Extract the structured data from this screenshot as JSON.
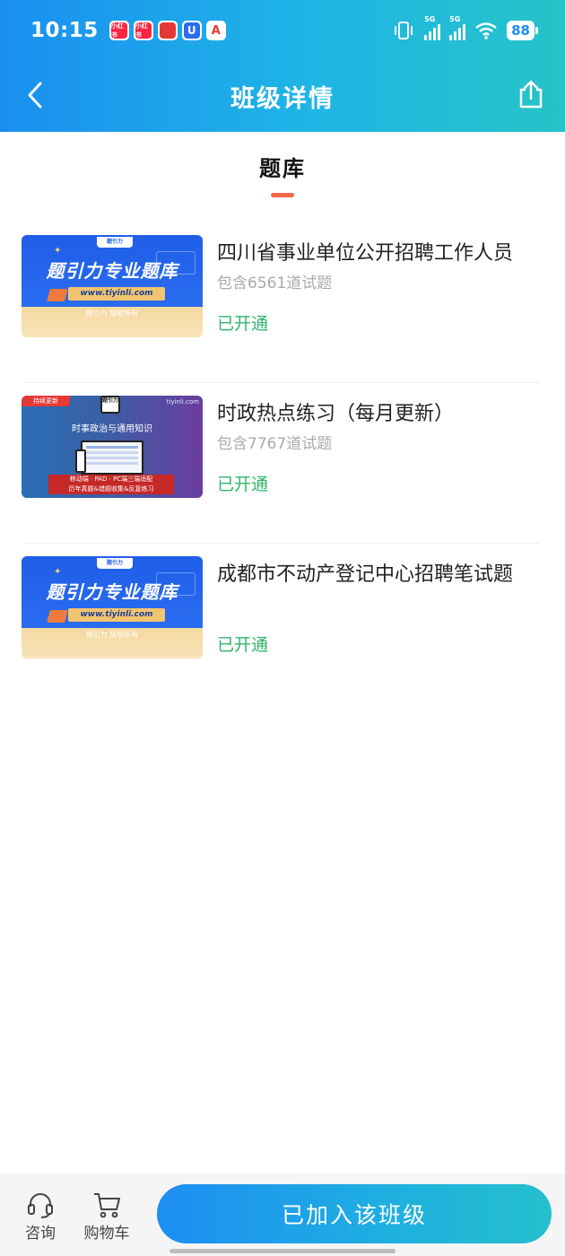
{
  "status_bar": {
    "time": "10:15",
    "apps": [
      {
        "icon": "xiaohongshu-icon",
        "label": "小红书",
        "color": "#ff2442"
      },
      {
        "icon": "xiaohongshu-icon",
        "label": "小红书",
        "color": "#ff2442"
      },
      {
        "icon": "app-icon",
        "label": "",
        "color": "#e53935"
      },
      {
        "icon": "u-app-icon",
        "label": "U",
        "color": "#2b6cf0"
      },
      {
        "icon": "a-app-icon",
        "label": "A",
        "color": "#e53935"
      }
    ],
    "network_1": "5G",
    "network_2": "5G",
    "battery": "88"
  },
  "nav": {
    "title": "班级详情"
  },
  "section": {
    "label": "题库"
  },
  "thumbnail_text": {
    "brand": "题引力专业题库",
    "url": "www.tiyinli.com",
    "copyright": "题引力 版权所有",
    "logo_small": "题引力",
    "tag": "持续更新",
    "site": "tiyinli.com",
    "topic": "时事政治与通用知识",
    "banner_line1": "移动端 · PAD · PC端三端适配",
    "banner_line2": "历年真题&错题收集&反复练习",
    "logo_block": "题引力"
  },
  "courses": [
    {
      "title": "四川省事业单位公开招聘工作人员",
      "count": "包含6561道试题",
      "status": "已开通",
      "thumb": "a"
    },
    {
      "title": "时政热点练习（每月更新）",
      "count": "包含7767道试题",
      "status": "已开通",
      "thumb": "b"
    },
    {
      "title": "成都市不动产登记中心招聘笔试题",
      "count": "",
      "status": "已开通",
      "thumb": "a"
    }
  ],
  "bottom_bar": {
    "consult_label": "咨询",
    "cart_label": "购物车",
    "join_label": "已加入该班级"
  },
  "colors": {
    "accent": "#1a8ff0",
    "status_green": "#2fb56a",
    "tab_underline": "#ef6a45"
  }
}
